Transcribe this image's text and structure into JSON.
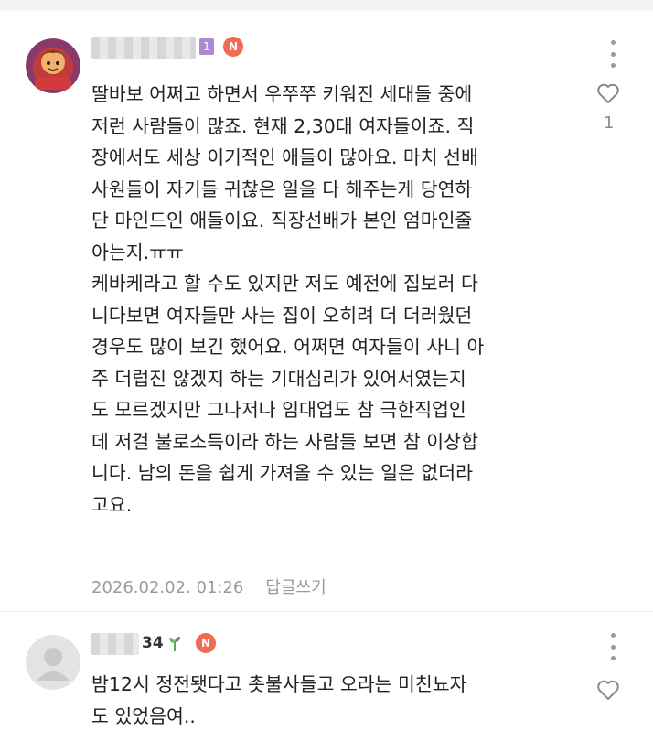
{
  "comments": [
    {
      "level_badge": "1",
      "new_badge": "N",
      "lines": [
        "딸바보 어쩌고 하면서 우쭈쭈 키워진 세대들 중에",
        "저런 사람들이 많죠. 현재 2,30대 여자들이죠. 직",
        "장에서도 세상 이기적인 애들이 많아요. 마치 선배",
        "사원들이 자기들 귀찮은 일을 다 해주는게 당연하",
        "단 마인드인 애들이요. 직장선배가 본인 엄마인줄",
        "아는지.ㅠㅠ",
        "케바케라고 할 수도 있지만 저도 예전에 집보러 다",
        "니다보면 여자들만 사는 집이 오히려 더 더러웠던",
        "경우도 많이 보긴 했어요. 어쩌면 여자들이 사니 아",
        "주 더럽진 않겠지 하는 기대심리가 있어서였는지",
        "도 모르겠지만 그나저나 임대업도 참 극한직업인",
        "데 저걸 불로소득이라 하는 사람들 보면 참 이상합",
        "니다. 남의 돈을 쉽게 가져올 수 있는 일은 없더라",
        "고요."
      ],
      "timestamp": "2026.02.02. 01:26",
      "reply_label": "답글쓰기",
      "like_count": "1"
    },
    {
      "username_suffix": "34",
      "new_badge": "N",
      "lines": [
        "밤12시 정전됏다고 촛불사들고 오라는 미친뇨자",
        "도 있었음여.."
      ]
    }
  ],
  "colors": {
    "new_badge": "#f06a55",
    "level_badge": "#a98bd1",
    "meta_text": "#9a9a9a"
  },
  "icons": [
    "more-vert-icon",
    "heart-outline-icon",
    "sprout-icon",
    "default-avatar-icon"
  ]
}
